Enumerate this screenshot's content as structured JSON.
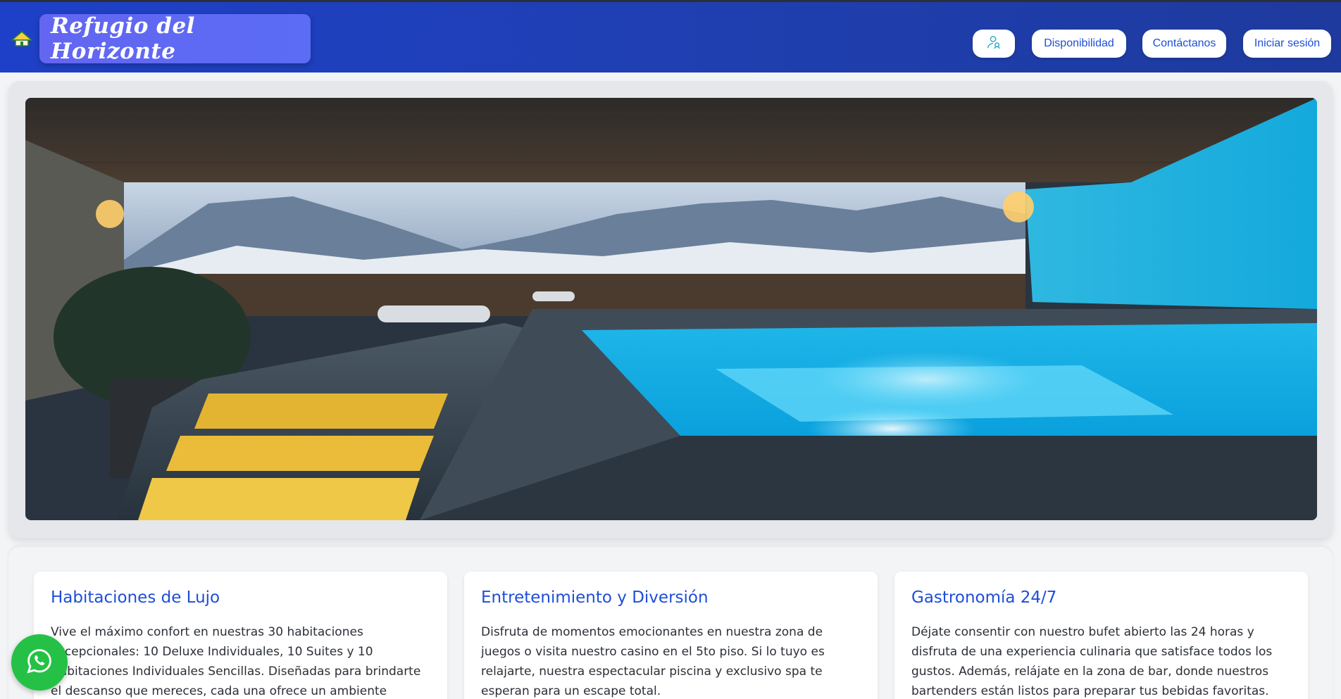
{
  "header": {
    "brand": "Refugio del Horizonte",
    "logo_icon": "mountain-house-icon",
    "nav": {
      "user_icon": "users-icon",
      "availability": "Disponibilidad",
      "contact": "Contáctanos",
      "login": "Iniciar sesión"
    }
  },
  "hero": {
    "image_icon": "spa-pool-mountain-image"
  },
  "features": [
    {
      "title": "Habitaciones de Lujo",
      "text": "Vive el máximo confort en nuestras 30 habitaciones excepcionales: 10 Deluxe Individuales, 10 Suites y 10 Habitaciones Individuales Sencillas. Diseñadas para brindarte el descanso que mereces, cada una ofrece un ambiente exclusivo y relajante."
    },
    {
      "title": "Entretenimiento y Diversión",
      "text": "Disfruta de momentos emocionantes en nuestra zona de juegos o visita nuestro casino en el 5to piso. Si lo tuyo es relajarte, nuestra espectacular piscina y exclusivo spa te esperan para un escape total."
    },
    {
      "title": "Gastronomía 24/7",
      "text": "Déjate consentir con nuestro bufet abierto las 24 horas y disfruta de una experiencia culinaria que satisface todos los gustos. Además, relájate en la zona de bar, donde nuestros bartenders están listos para preparar tus bebidas favoritas."
    }
  ],
  "floating": {
    "whatsapp_icon": "whatsapp-icon"
  },
  "colors": {
    "header": "#1e40c8",
    "brand_box": "#6366f1",
    "accent_text": "#1d4ed8",
    "whatsapp": "#25c146"
  }
}
